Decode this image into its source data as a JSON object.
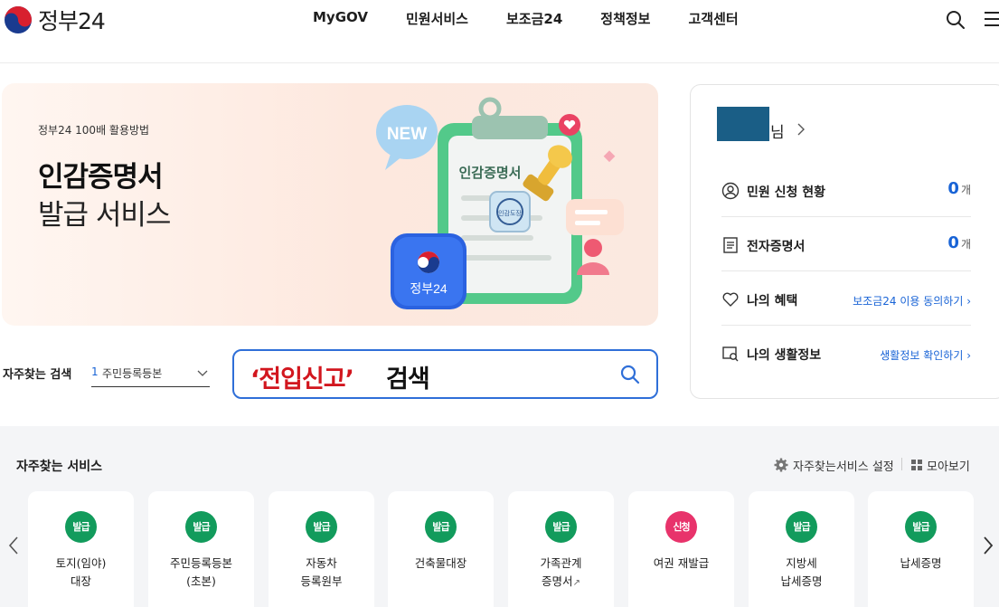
{
  "header": {
    "logo_text": "정부24",
    "nav": [
      "MyGOV",
      "민원서비스",
      "보조금24",
      "정책정보",
      "고객센터"
    ],
    "search_icon": "search-icon",
    "menu_icon": "hamburger-menu-icon"
  },
  "banner": {
    "kicker": "정부24 100배 활용방법",
    "title": "인감증명서",
    "subtitle": "발급 서비스",
    "art_new": "NEW",
    "art_doc": "인감증명서",
    "art_seal": "인감도장",
    "art_app": "정부24"
  },
  "search": {
    "fav_label": "자주찾는 검색",
    "fav_num": "1",
    "fav_value": "주민등록등본",
    "query_highlight": "‘전입신고’",
    "query_rest": "검색"
  },
  "mycard": {
    "user_suffix": "님",
    "rows": [
      {
        "label": "민원 신청 현황",
        "count": "0",
        "unit": "개"
      },
      {
        "label": "전자증명서",
        "count": "0",
        "unit": "개"
      },
      {
        "label": "나의 혜택",
        "link": "보조금24 이용 동의하기 ›"
      },
      {
        "label": "나의 생활정보",
        "link": "생활정보 확인하기 ›"
      }
    ]
  },
  "services": {
    "title": "자주찾는 서비스",
    "setting_label": "자주찾는서비스 설정",
    "all_label": "모아보기",
    "items": [
      {
        "badge": "발급",
        "line1": "토지(임야)",
        "line2": "대장"
      },
      {
        "badge": "발급",
        "line1": "주민등록등본",
        "line2": "(초본)"
      },
      {
        "badge": "발급",
        "line1": "자동차",
        "line2": "등록원부"
      },
      {
        "badge": "발급",
        "line1": "건축물대장",
        "line2": ""
      },
      {
        "badge": "발급",
        "line1": "가족관계",
        "line2": "증명서"
      },
      {
        "badge": "신청",
        "line1": "여권 재발급",
        "line2": ""
      },
      {
        "badge": "발급",
        "line1": "지방세",
        "line2": "납세증명"
      },
      {
        "badge": "발급",
        "line1": "납세증명",
        "line2": ""
      }
    ]
  },
  "colors": {
    "accent": "#1863d6",
    "issue_badge": "#129b5c",
    "apply_badge": "#e8336b",
    "highlight_red": "#d2161e"
  }
}
